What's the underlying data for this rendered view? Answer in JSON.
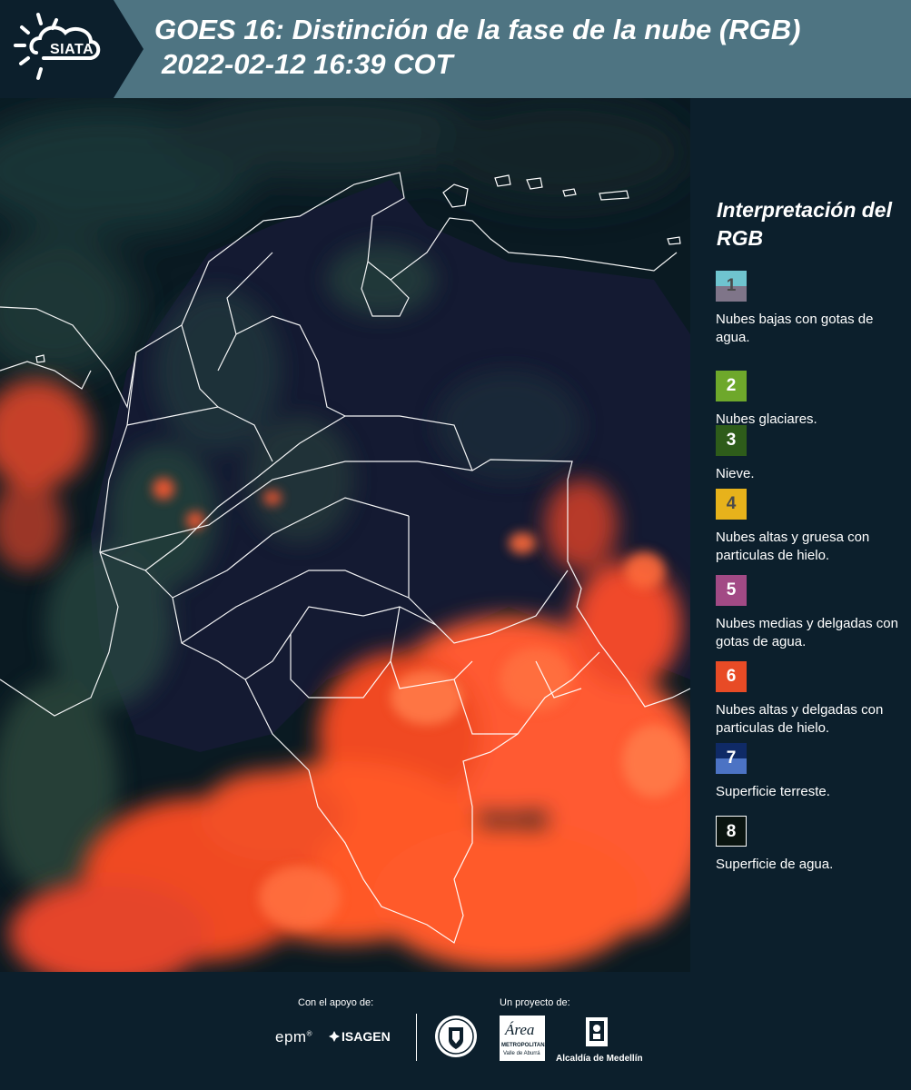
{
  "header": {
    "logo_text": "SIATA",
    "title_line1": "GOES 16: Distinción de la fase de la nube (RGB)",
    "title_line2": "2022-02-12 16:39 COT"
  },
  "legend": {
    "title": "Interpretación del RGB",
    "items": [
      {
        "number": "1",
        "label": "Nubes bajas con gotas de agua.",
        "color_top": "#6fc4cf",
        "color_bottom": "#7f7589",
        "text_color": "#4a4a4a"
      },
      {
        "number": "2",
        "label": "Nubes glaciares.",
        "color_top": "#6ea82b",
        "color_bottom": "#6ea82b",
        "text_color": "#ffffff"
      },
      {
        "number": "3",
        "label": "Nieve.",
        "color_top": "#2e5c1a",
        "color_bottom": "#2e5c1a",
        "text_color": "#ffffff"
      },
      {
        "number": "4",
        "label": "Nubes altas y gruesa con particulas de hielo.",
        "color_top": "#e7b21b",
        "color_bottom": "#e7b21b",
        "text_color": "#4a4a4a"
      },
      {
        "number": "5",
        "label": "Nubes medias y delgadas con gotas de agua.",
        "color_top": "#a24a85",
        "color_bottom": "#a24a85",
        "text_color": "#ffffff"
      },
      {
        "number": "6",
        "label": "Nubes altas y delgadas con particulas de hielo.",
        "color_top": "#e84b26",
        "color_bottom": "#e84b26",
        "text_color": "#ffffff"
      },
      {
        "number": "7",
        "label": "Superficie terreste.",
        "color_top": "#0f2a66",
        "color_bottom": "#4c73c4",
        "text_color": "#ffffff"
      },
      {
        "number": "8",
        "label": "Superficie de agua.",
        "color_top": "#0a1410",
        "color_bottom": "#0a1410",
        "text_color": "#ffffff"
      }
    ]
  },
  "footer": {
    "support_caption": "Con el apoyo de:",
    "project_caption": "Un proyecto de:",
    "sponsor_epm": "epm",
    "sponsor_isagen": "ISAGEN",
    "area_logo_word": "Área",
    "area_sub1": "METROPOLITANA",
    "area_sub2": "Valle de Aburrá",
    "alcaldia": "Alcaldía de Medellín"
  },
  "colors": {
    "header_bg": "#4e7482",
    "logo_bg": "#0c1f2c",
    "footer_bg": "#0c1f2c",
    "cloud_red": "#ff5a2c",
    "land_dark": "#141c34",
    "border_white": "#ffffff"
  }
}
